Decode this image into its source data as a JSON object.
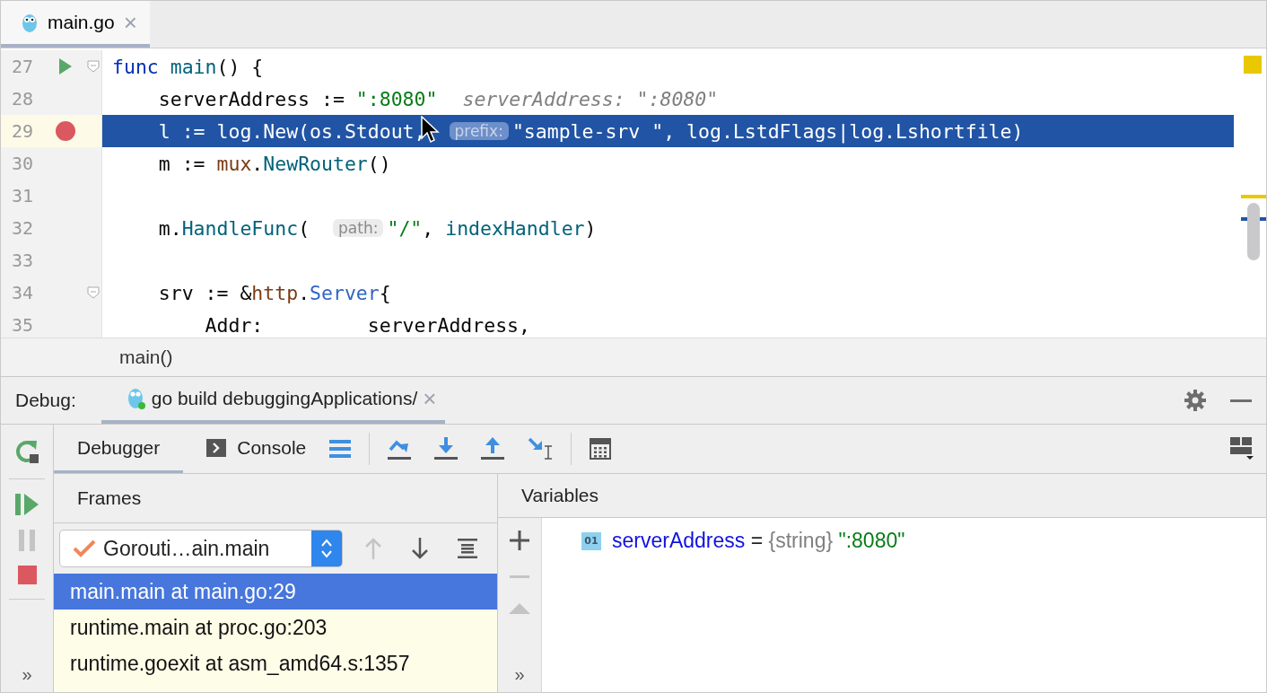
{
  "editor_tab": {
    "label": "main.go",
    "close": "×",
    "selected": true
  },
  "code_lines": [
    {
      "number": "27",
      "run_marker": true,
      "breakpoint": false,
      "fold": true,
      "selected": false,
      "tokens": [
        {
          "kind": "keyword",
          "text": "func"
        },
        {
          "kind": "function",
          "text": " main"
        },
        {
          "kind": "plain",
          "text": "() {"
        }
      ]
    },
    {
      "number": "28",
      "run_marker": false,
      "breakpoint": false,
      "fold": false,
      "selected": false,
      "tokens": [
        {
          "kind": "plain",
          "text": "    serverAddress := "
        },
        {
          "kind": "string",
          "text": "\":8080\""
        },
        {
          "kind": "hint",
          "text": "serverAddress: \":8080\""
        }
      ]
    },
    {
      "number": "29",
      "run_marker": false,
      "breakpoint": true,
      "fold": false,
      "selected": true,
      "tokens": [
        {
          "kind": "plain",
          "text": "    l := log.New(os.Stdout,"
        },
        {
          "kind": "inlay",
          "text": "prefix:"
        },
        {
          "kind": "string",
          "text": "\"sample-srv \""
        },
        {
          "kind": "plain",
          "text": ", log.LstdFlags|log.Lshortfile)"
        }
      ]
    },
    {
      "number": "30",
      "run_marker": false,
      "breakpoint": false,
      "fold": false,
      "selected": false,
      "tokens": [
        {
          "kind": "plain",
          "text": "    m := "
        },
        {
          "kind": "package",
          "text": "mux"
        },
        {
          "kind": "plain",
          "text": "."
        },
        {
          "kind": "function",
          "text": "NewRouter"
        },
        {
          "kind": "plain",
          "text": "()"
        }
      ]
    },
    {
      "number": "31",
      "run_marker": false,
      "breakpoint": false,
      "fold": false,
      "selected": false
    },
    {
      "number": "32",
      "run_marker": false,
      "breakpoint": false,
      "fold": false,
      "selected": false,
      "tokens": [
        {
          "kind": "plain",
          "text": "    m."
        },
        {
          "kind": "function",
          "text": "HandleFunc"
        },
        {
          "kind": "plain",
          "text": "("
        },
        {
          "kind": "inlay",
          "text": "path:"
        },
        {
          "kind": "string",
          "text": "\"/\""
        },
        {
          "kind": "plain",
          "text": ", "
        },
        {
          "kind": "function",
          "text": "indexHandler"
        },
        {
          "kind": "plain",
          "text": ")"
        }
      ]
    },
    {
      "number": "33",
      "run_marker": false,
      "breakpoint": false,
      "fold": false,
      "selected": false
    },
    {
      "number": "34",
      "run_marker": false,
      "breakpoint": false,
      "fold": true,
      "selected": false,
      "tokens": [
        {
          "kind": "plain",
          "text": "    srv := &"
        },
        {
          "kind": "package",
          "text": "http"
        },
        {
          "kind": "plain",
          "text": "."
        },
        {
          "kind": "type",
          "text": "Server"
        },
        {
          "kind": "plain",
          "text": "{"
        }
      ]
    },
    {
      "number": "35",
      "run_marker": false,
      "breakpoint": false,
      "fold": false,
      "selected": false,
      "tokens": [
        {
          "kind": "plain",
          "text": "        Addr:         serverAddress,"
        }
      ]
    }
  ],
  "breadcrumb": "main()",
  "debug": {
    "label": "Debug:",
    "session_tab": {
      "label": "go build debuggingApplications/",
      "close": "×",
      "selected": true
    }
  },
  "tabs": [
    {
      "label": "Debugger",
      "selected": true,
      "kind": "debugger"
    },
    {
      "label": "Console",
      "selected": false,
      "kind": "console"
    }
  ],
  "more": "»",
  "frames": {
    "title": "Frames",
    "goroutine": "Gorouti…ain.main",
    "rows": [
      {
        "text": "main.main at main.go:29",
        "selected": true
      },
      {
        "text": "runtime.main at proc.go:203",
        "selected": false
      },
      {
        "text": "runtime.goexit at asm_amd64.s:1357",
        "selected": false
      }
    ]
  },
  "variables": {
    "title": "Variables",
    "more": "»",
    "items": [
      {
        "icon_text": "01",
        "name": "serverAddress",
        "operator": "=",
        "type": "{string}",
        "value": "\":8080\""
      }
    ]
  }
}
